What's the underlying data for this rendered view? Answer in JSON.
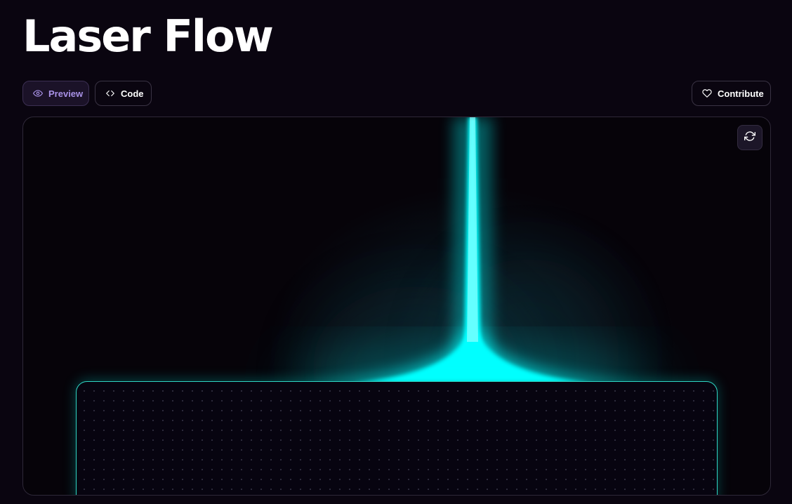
{
  "page": {
    "title": "Laser Flow"
  },
  "toolbar": {
    "preview_label": "Preview",
    "code_label": "Code",
    "contribute_label": "Contribute",
    "active_tab": "Preview"
  },
  "preview": {
    "icons": {
      "refresh": "refresh-icon",
      "preview": "eye-icon",
      "code": "code-brackets-icon",
      "contribute": "heart-icon"
    },
    "beam_color": "#00ffff",
    "accent_color": "#a891e6",
    "background": "#060309"
  }
}
